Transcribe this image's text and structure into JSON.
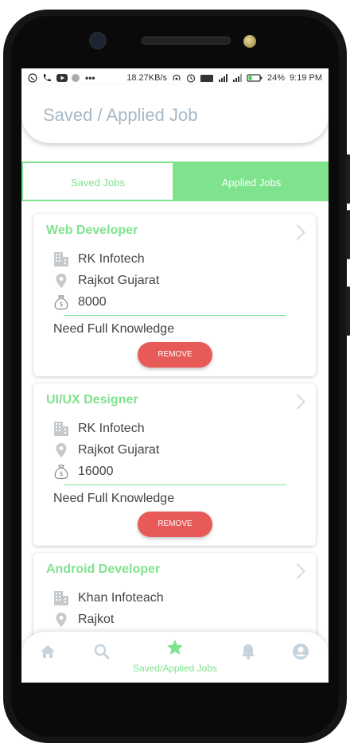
{
  "status_bar": {
    "speed": "18.27KB/s",
    "battery": "24%",
    "time": "9:19 PM",
    "dots": "•••"
  },
  "header": {
    "title": "Saved / Applied Job"
  },
  "tabs": {
    "saved": "Saved Jobs",
    "applied": "Applied Jobs"
  },
  "jobs": [
    {
      "title": "Web Developer",
      "company": "RK Infotech",
      "location": "Rajkot Gujarat",
      "salary": "8000",
      "description": "Need Full Knowledge",
      "remove_label": "REMOVE"
    },
    {
      "title": "UI/UX Designer",
      "company": "RK Infotech",
      "location": "Rajkot Gujarat",
      "salary": "16000",
      "description": "Need Full Knowledge",
      "remove_label": "REMOVE"
    },
    {
      "title": "Android Developer",
      "company": "Khan Infoteach",
      "location": "Rajkot"
    }
  ],
  "bottom_nav": {
    "active_label": "Saved/Applied Jobs",
    "items": [
      "home-icon",
      "search-icon",
      "star-icon",
      "bell-icon",
      "account-icon"
    ]
  },
  "colors": {
    "accent": "#7fe38e",
    "remove": "#e85a57",
    "header_text": "#a6b8c8",
    "nav_icon": "#c5d3dd"
  }
}
